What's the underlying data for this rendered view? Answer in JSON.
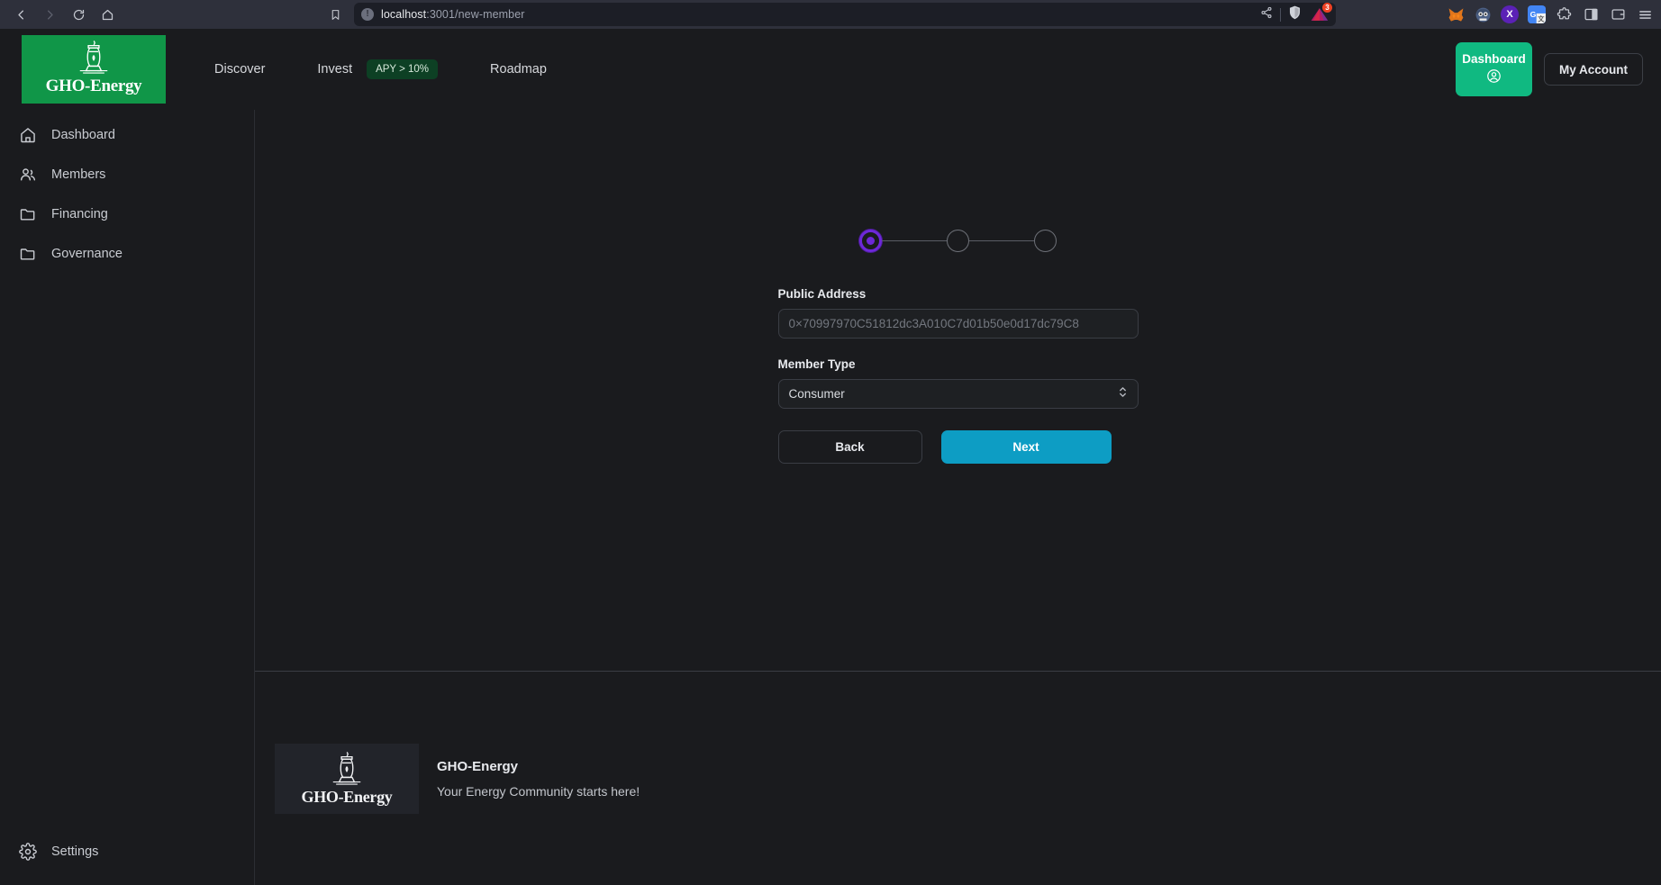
{
  "browser": {
    "nav": {
      "back": "back-arrow",
      "forward": "forward-arrow",
      "reload": "reload",
      "home": "home"
    },
    "bookmark_icon": "bookmark-icon",
    "url_display": "localhost",
    "url_rest": ":3001/new-member",
    "info_glyph": "!",
    "share_icon": "share-icon",
    "shield_icon": "brave-shield-icon",
    "notification_count": "3",
    "extensions": [
      {
        "name": "metamask-extension-icon",
        "label": ""
      },
      {
        "name": "pooly-extension-icon",
        "label": ""
      },
      {
        "name": "x-extension-icon",
        "label": "X"
      },
      {
        "name": "google-translate-extension-icon",
        "label": "G"
      },
      {
        "name": "extensions-puzzle-icon",
        "label": ""
      },
      {
        "name": "sidebar-toggle-icon",
        "label": ""
      },
      {
        "name": "wallet-icon",
        "label": ""
      },
      {
        "name": "browser-menu-icon",
        "label": ""
      }
    ]
  },
  "header": {
    "logo_word": "GHO-Energy",
    "nav": [
      {
        "label": "Discover"
      },
      {
        "label": "Invest"
      },
      {
        "label": "Roadmap"
      }
    ],
    "apy_badge": "APY > 10%",
    "dashboard_button": "Dashboard",
    "account_button": "My Account"
  },
  "sidebar": {
    "items": [
      {
        "label": "Dashboard",
        "icon": "home-icon"
      },
      {
        "label": "Members",
        "icon": "people-icon"
      },
      {
        "label": "Financing",
        "icon": "folder-icon"
      },
      {
        "label": "Governance",
        "icon": "folder-icon"
      }
    ],
    "settings": {
      "label": "Settings",
      "icon": "gear-icon"
    }
  },
  "main": {
    "stepper": {
      "total_steps": 3,
      "active_step": 1,
      "active_color": "#6d28d9",
      "inactive_color": "#6e7178"
    },
    "form": {
      "address_label": "Public Address",
      "address_value": "",
      "address_placeholder": "0×70997970C51812dc3A010C7d01b50e0d17dc79C8",
      "member_type_label": "Member Type",
      "member_type_value": "Consumer",
      "member_type_options": [
        "Consumer"
      ]
    },
    "buttons": {
      "back": "Back",
      "next": "Next",
      "next_color": "#0d9dc4"
    }
  },
  "footer": {
    "logo_word": "GHO-Energy",
    "title": "GHO-Energy",
    "tagline": "Your Energy Community starts here!"
  }
}
